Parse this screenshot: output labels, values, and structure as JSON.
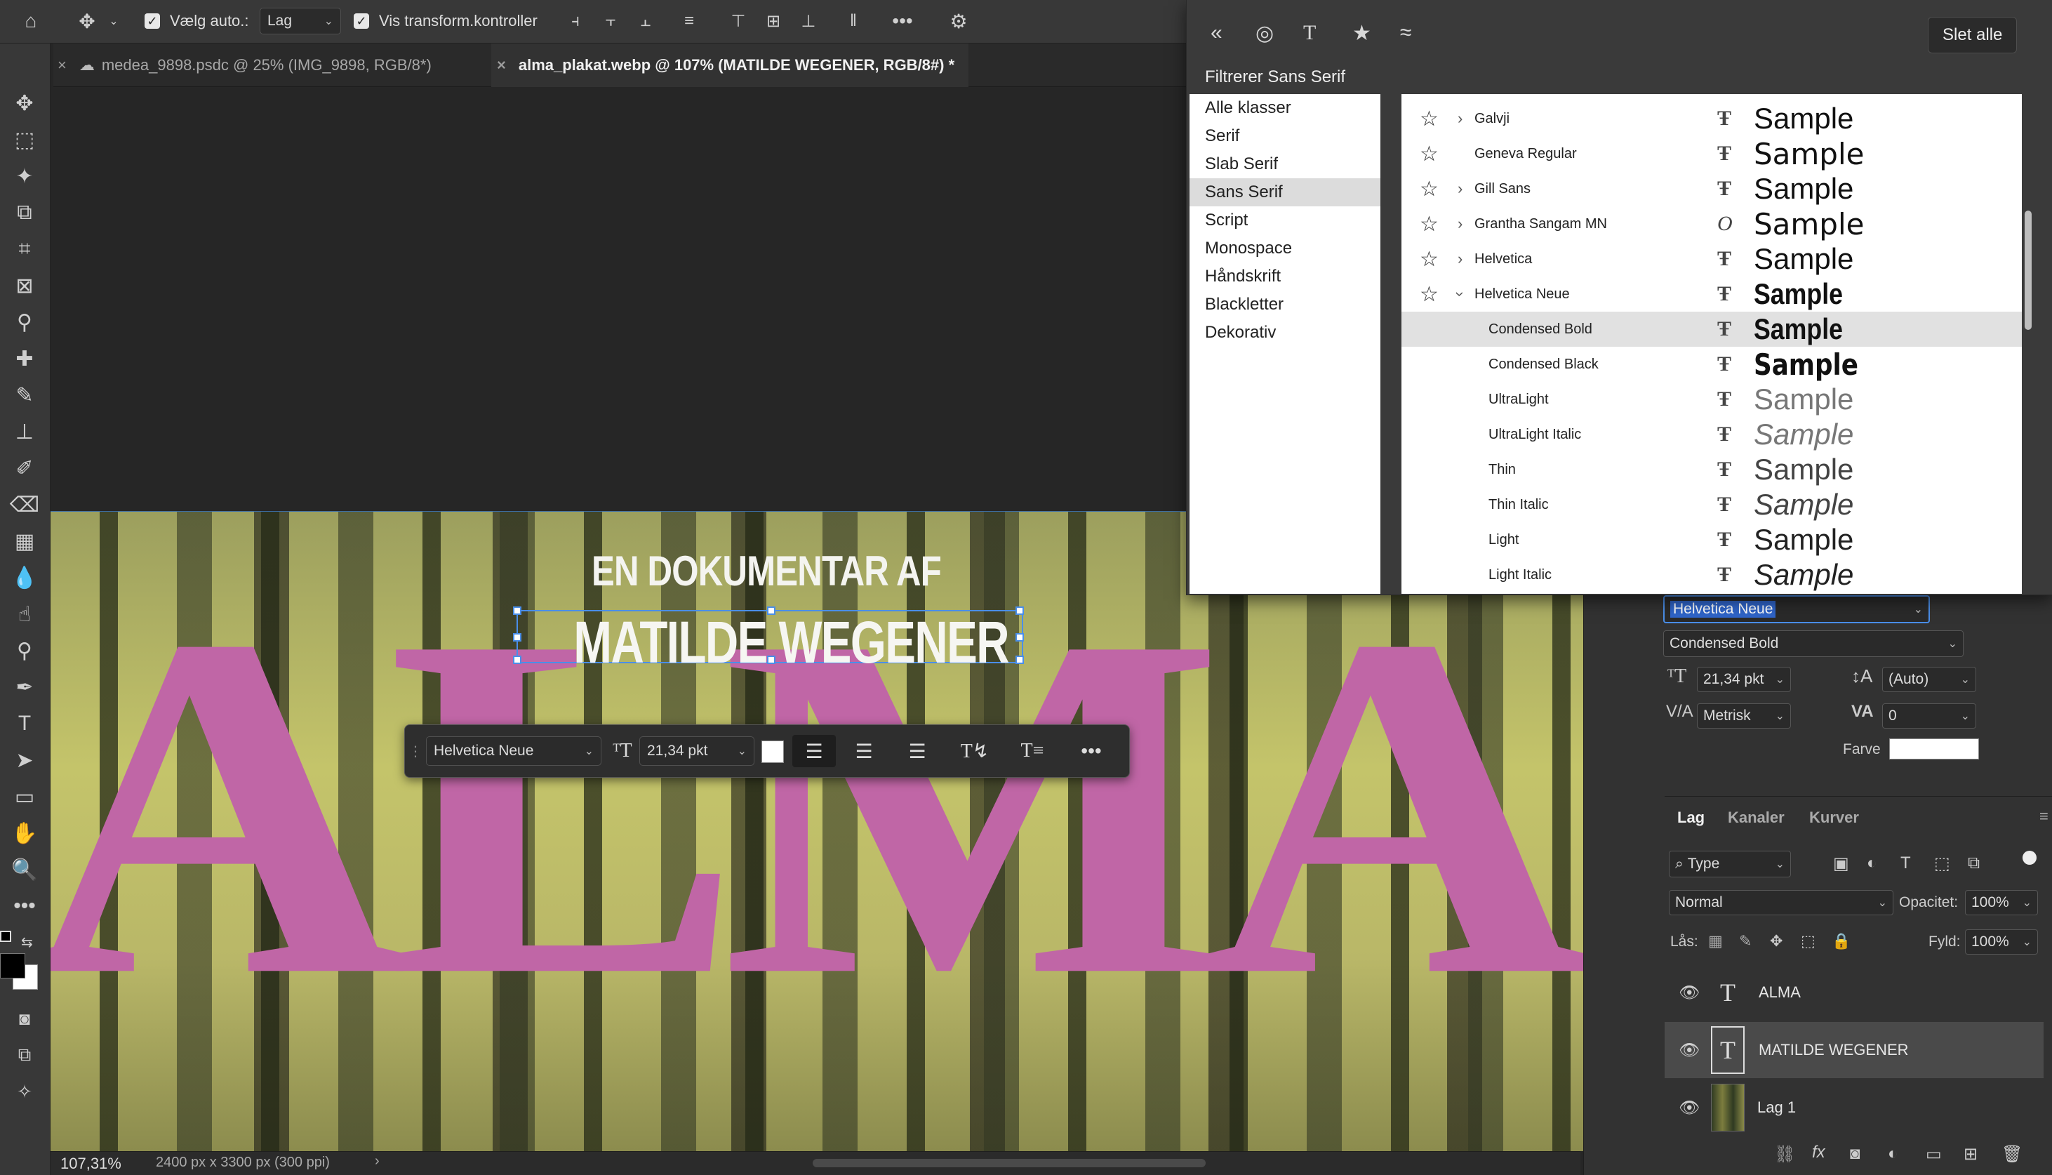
{
  "options_bar": {
    "auto_select_label": "Vælg auto.:",
    "auto_select_value": "Lag",
    "show_transform_label": "Vis transform.kontroller"
  },
  "tabs": [
    {
      "label": "medea_9898.psdc @ 25% (IMG_9898, RGB/8*)",
      "active": false
    },
    {
      "label": "alma_plakat.webp @ 107% (MATILDE WEGENER, RGB/8#) *",
      "active": true
    }
  ],
  "artwork": {
    "alma_text": "ALMA",
    "subtitle": "EN DOKUMENTAR AF",
    "name": "MATILDE WEGENER",
    "accent_color": "#c066a6"
  },
  "context_bar": {
    "font": "Helvetica Neue",
    "size": "21,34 pkt"
  },
  "status_bar": {
    "zoom": "107,31%",
    "doc_info": "2400 px x 3300 px (300 ppi)"
  },
  "font_popup": {
    "clear_all": "Slet alle",
    "filter_label": "Filtrerer Sans Serif",
    "classes": [
      "Alle klasser",
      "Serif",
      "Slab Serif",
      "Sans Serif",
      "Script",
      "Monospace",
      "Håndskrift",
      "Blackletter",
      "Dekorativ"
    ],
    "selected_class": "Sans Serif",
    "sample_text": "Sample",
    "fonts": [
      {
        "name": "Galvji",
        "family": true,
        "expanded": false,
        "type_icon": "truetype-icon"
      },
      {
        "name": "Geneva Regular",
        "family": false,
        "type_icon": "truetype-icon"
      },
      {
        "name": "Gill Sans",
        "family": true,
        "expanded": false,
        "type_icon": "truetype-icon"
      },
      {
        "name": "Grantha Sangam MN",
        "family": true,
        "expanded": false,
        "type_icon": "opentype-icon"
      },
      {
        "name": "Helvetica",
        "family": true,
        "expanded": false,
        "type_icon": "truetype-icon"
      },
      {
        "name": "Helvetica Neue",
        "family": true,
        "expanded": true,
        "type_icon": "truetype-icon"
      },
      {
        "name": "Condensed Bold",
        "style": true,
        "selected": true,
        "type_icon": "truetype-icon"
      },
      {
        "name": "Condensed Black",
        "style": true,
        "type_icon": "truetype-icon"
      },
      {
        "name": "UltraLight",
        "style": true,
        "type_icon": "truetype-icon"
      },
      {
        "name": "UltraLight Italic",
        "style": true,
        "type_icon": "truetype-icon"
      },
      {
        "name": "Thin",
        "style": true,
        "type_icon": "truetype-icon"
      },
      {
        "name": "Thin Italic",
        "style": true,
        "type_icon": "truetype-icon"
      },
      {
        "name": "Light",
        "style": true,
        "type_icon": "truetype-icon"
      },
      {
        "name": "Light Italic",
        "style": true,
        "type_icon": "truetype-icon"
      }
    ]
  },
  "character_panel": {
    "font_family": "Helvetica Neue",
    "font_style": "Condensed Bold",
    "size": "21,34 pkt",
    "leading": "(Auto)",
    "kerning": "Metrisk",
    "tracking": "0",
    "color_label": "Farve"
  },
  "layers_panel": {
    "tabs": [
      "Lag",
      "Kanaler",
      "Kurver"
    ],
    "filter": "Type",
    "blend_mode": "Normal",
    "opacity_label": "Opacitet:",
    "opacity_value": "100%",
    "lock_label": "Lås:",
    "fill_label": "Fyld:",
    "fill_value": "100%",
    "layers": [
      {
        "name": "ALMA",
        "kind": "text"
      },
      {
        "name": "MATILDE WEGENER",
        "kind": "text",
        "selected": true
      },
      {
        "name": "Lag 1",
        "kind": "image"
      }
    ]
  }
}
